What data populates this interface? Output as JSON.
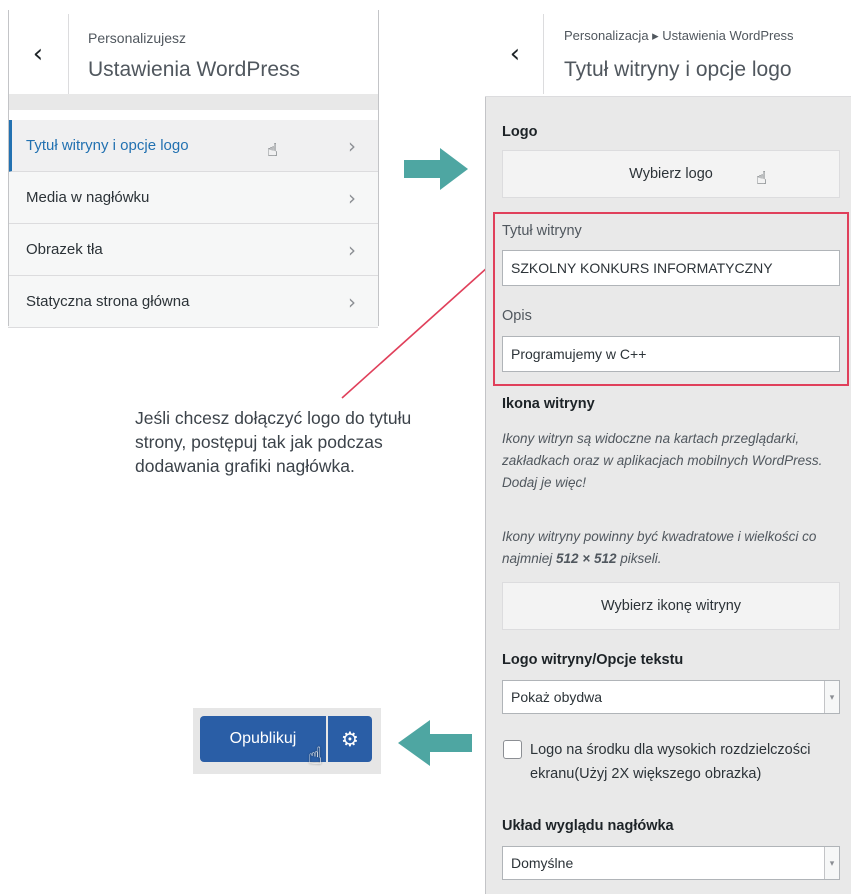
{
  "left_panel": {
    "subtitle": "Personalizujesz",
    "title": "Ustawienia WordPress",
    "menu_items": [
      {
        "label": "Tytuł witryny i opcje logo"
      },
      {
        "label": "Media w nagłówku"
      },
      {
        "label": "Obrazek tła"
      },
      {
        "label": "Statyczna strona główna"
      }
    ]
  },
  "callout": {
    "text": "Jeśli chcesz dołączyć logo do tytułu strony, postępuj tak jak podczas dodawania grafiki nagłówka."
  },
  "publish": {
    "label": "Opublikuj"
  },
  "right_panel": {
    "breadcrumb": "Personalizacja ▸ Ustawienia WordPress",
    "title": "Tytuł witryny i opcje logo",
    "logo": {
      "label": "Logo",
      "button": "Wybierz logo"
    },
    "site_title": {
      "label": "Tytuł witryny",
      "value": "SZKOLNY KONKURS INFORMATYCZNY"
    },
    "tagline": {
      "label": "Opis",
      "value": "Programujemy w C++"
    },
    "site_icon": {
      "label": "Ikona witryny",
      "desc1": "Ikony witryn są widoczne na kartach przeglądarki, zakładkach oraz w aplikacjach mobilnych WordPress. Dodaj je więc!",
      "desc2a": "Ikony witryny powinny być kwadratowe i wielkości co najmniej ",
      "desc2b": "512 × 512",
      "desc2c": " pikseli.",
      "button": "Wybierz ikonę witryny"
    },
    "logo_text": {
      "label": "Logo witryny/Opcje tekstu",
      "selected": "Pokaż obydwa"
    },
    "checkbox": {
      "label": "Logo na środku dla wysokich rozdzielczości ekranu(Użyj 2X większego obrazka)"
    },
    "header_layout": {
      "label": "Układ wyglądu nagłówka",
      "selected": "Domyślne"
    }
  },
  "colors": {
    "accent": "#2271b1",
    "publish": "#2a5ea6",
    "arrow": "#4ea6a2",
    "highlight": "#e0405b"
  }
}
